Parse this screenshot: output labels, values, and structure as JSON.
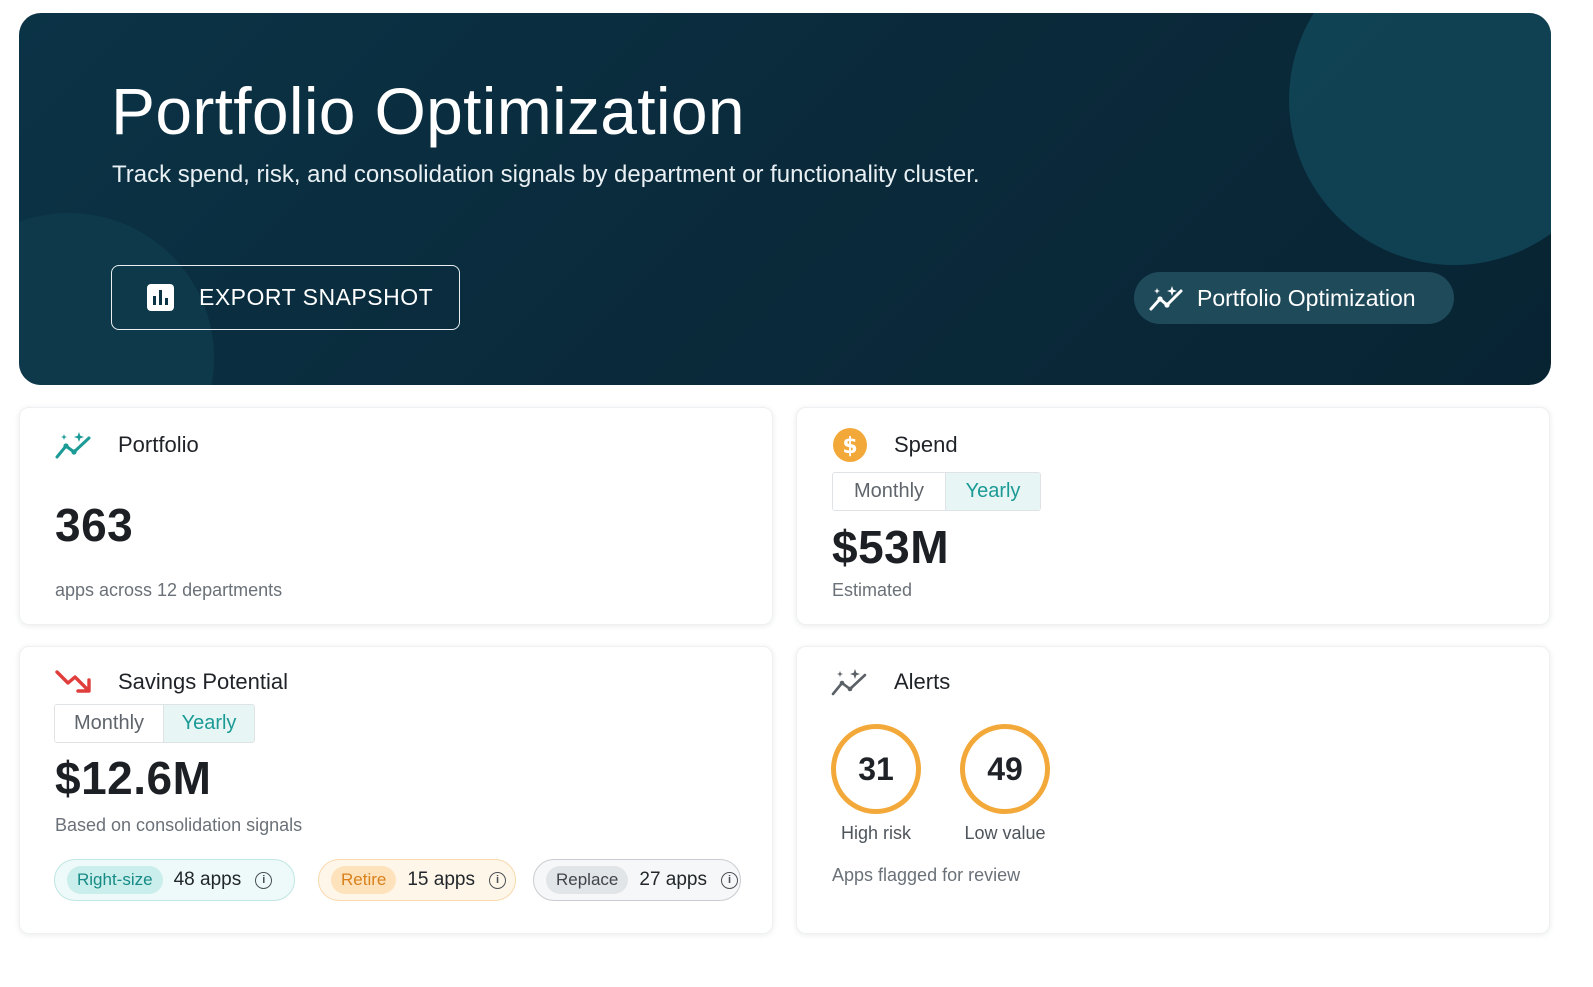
{
  "hero": {
    "title": "Portfolio Optimization",
    "subtitle": "Track spend, risk, and consolidation signals by department or functionality cluster.",
    "export_label": "EXPORT SNAPSHOT",
    "pill_label": "Portfolio Optimization"
  },
  "portfolio": {
    "title": "Portfolio",
    "value": "363",
    "caption": "apps across 12 departments"
  },
  "spend": {
    "title": "Spend",
    "toggle": {
      "monthly": "Monthly",
      "yearly": "Yearly",
      "selected": "Yearly"
    },
    "value": "$53M",
    "caption": "Estimated"
  },
  "savings": {
    "title": "Savings Potential",
    "toggle": {
      "monthly": "Monthly",
      "yearly": "Yearly",
      "selected": "Yearly"
    },
    "value": "$12.6M",
    "caption": "Based on consolidation signals",
    "chips": [
      {
        "tag": "Right-size",
        "count": "48 apps"
      },
      {
        "tag": "Retire",
        "count": "15 apps"
      },
      {
        "tag": "Replace",
        "count": "27 apps"
      }
    ]
  },
  "alerts": {
    "title": "Alerts",
    "high_risk": {
      "value": "31",
      "label": "High risk"
    },
    "low_value": {
      "value": "49",
      "label": "Low value"
    },
    "caption": "Apps flagged for review"
  },
  "colors": {
    "hero_bg": "#0b3346",
    "teal_accent": "#1b9a96",
    "orange_accent": "#f3a93a",
    "red_trend": "#e03d3d"
  }
}
